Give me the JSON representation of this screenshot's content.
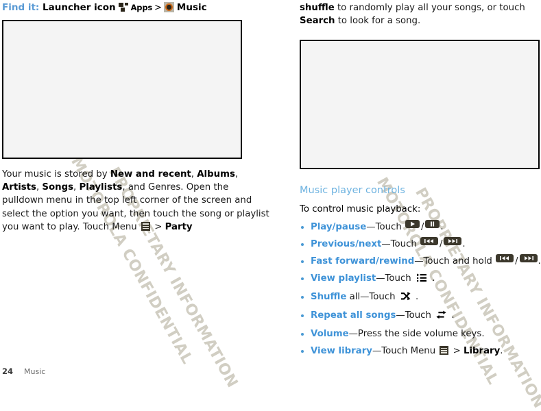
{
  "watermark": {
    "line1": "MOTOROLA CONFIDENTIAL",
    "line2": "PROPRIETARY INFORMATION"
  },
  "left": {
    "findit": {
      "label": "Find it:",
      "launcher_label": "Launcher icon",
      "apps_label": "Apps",
      "separator": ">",
      "music_label": "Music",
      "apps_icon": "apps-grid-icon",
      "music_icon": "music-vinyl-icon"
    },
    "figure_alt": "music-library-screenshot",
    "paragraph": {
      "t1": "Your music is stored by ",
      "b1": "New and recent",
      "t2": ", ",
      "b2": "Albums",
      "t3": ", ",
      "b3": "Artists",
      "t4": ", ",
      "b4": "Songs",
      "t5": ", ",
      "b5": "Playlists",
      "t6": ", and Genres. Open the pulldown menu in the top left corner of the screen and select the option you want, then touch the song or playlist you want to play. Touch Menu ",
      "menu_icon": "menu-icon",
      "t7": " > ",
      "b6": "Party"
    }
  },
  "right": {
    "top_paragraph": {
      "b1": "shuffle",
      "t1": " to randomly play all your songs, or touch ",
      "b2": "Search",
      "t2": " to look for a song."
    },
    "figure_alt": "music-player-screenshot",
    "section_heading": "Music player controls",
    "lead": "To control music playback:",
    "bullets": [
      {
        "term": "Play/pause",
        "mid": "—Touch ",
        "icons": [
          "play-icon",
          "pause-icon"
        ],
        "tail": "."
      },
      {
        "term": "Previous/next",
        "mid": "—Touch ",
        "icons": [
          "previous-track-icon",
          "next-track-icon"
        ],
        "tail": "."
      },
      {
        "term": "Fast forward/rewind",
        "mid": "—Touch and hold ",
        "icons": [
          "rewind-icon",
          "fast-forward-icon"
        ],
        "tail": "."
      },
      {
        "term": "View playlist",
        "mid": "—Touch ",
        "icons": [
          "view-playlist-icon"
        ],
        "tail": " ."
      },
      {
        "term": "Shuffle",
        "mid": " all—Touch ",
        "icons": [
          "shuffle-icon"
        ],
        "tail": " ."
      },
      {
        "term": "Repeat all songs",
        "mid": "—Touch ",
        "icons": [
          "repeat-icon"
        ],
        "tail": " ."
      },
      {
        "term": "Volume",
        "mid": "—Press the side volume keys.",
        "icons": [],
        "tail": ""
      },
      {
        "term": "View library",
        "mid": "—Touch Menu ",
        "icons": [
          "menu-icon"
        ],
        "tail": " > ",
        "tail_bold": "Library",
        "tail_end": "."
      }
    ]
  },
  "footer": {
    "page_number": "24",
    "chapter": "Music"
  },
  "colors": {
    "accent_blue": "#3f93d8",
    "heading_blue": "#6eb3e0",
    "key_dark": "#3c382c",
    "watermark": "#cfccc0",
    "figure_fill": "#f4f4f4"
  }
}
